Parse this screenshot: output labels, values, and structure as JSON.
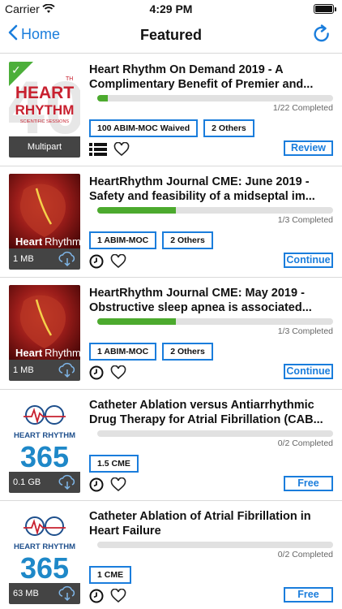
{
  "status_bar": {
    "carrier": "Carrier",
    "time": "4:29 PM"
  },
  "nav": {
    "back_label": "Home",
    "title": "Featured"
  },
  "colors": {
    "accent": "#1a7ddc",
    "progress": "#4caa2e"
  },
  "items": [
    {
      "title": "Heart Rhythm On Demand 2019 - A Complimentary Benefit of Premier and...",
      "progress": 0.045,
      "completed_text": "1/22 Completed",
      "badges": [
        "100 ABIM-MOC Waived",
        "2 Others"
      ],
      "footer": "Multipart",
      "action": "Review",
      "thumb_text": "40 HEART RHYTHM SCIENTIFIC SESSIONS"
    },
    {
      "title": "HeartRhythm Journal CME: June 2019 - Safety and feasibility of a midseptal im...",
      "progress": 0.333,
      "completed_text": "1/3 Completed",
      "badges": [
        "1 ABIM-MOC",
        "2 Others"
      ],
      "footer": "1 MB",
      "action": "Continue",
      "thumb_text": "HeartRhythm"
    },
    {
      "title": "HeartRhythm Journal CME: May 2019 - Obstructive sleep apnea is associated...",
      "progress": 0.333,
      "completed_text": "1/3 Completed",
      "badges": [
        "1 ABIM-MOC",
        "2 Others"
      ],
      "footer": "1 MB",
      "action": "Continue",
      "thumb_text": "HeartRhythm"
    },
    {
      "title": "Catheter Ablation versus Antiarrhythmic Drug Therapy for Atrial Fibrillation (CAB...",
      "progress": 0,
      "completed_text": "0/2 Completed",
      "badges": [
        "1.5 CME"
      ],
      "footer": "0.1 GB",
      "action": "Free",
      "thumb_text": "HEART RHYTHM 365"
    },
    {
      "title": "Catheter Ablation of Atrial Fibrillation in Heart Failure",
      "progress": 0,
      "completed_text": "0/2 Completed",
      "badges": [
        "1 CME"
      ],
      "footer": "63 MB",
      "action": "Free",
      "thumb_text": "HEART RHYTHM 365"
    }
  ]
}
